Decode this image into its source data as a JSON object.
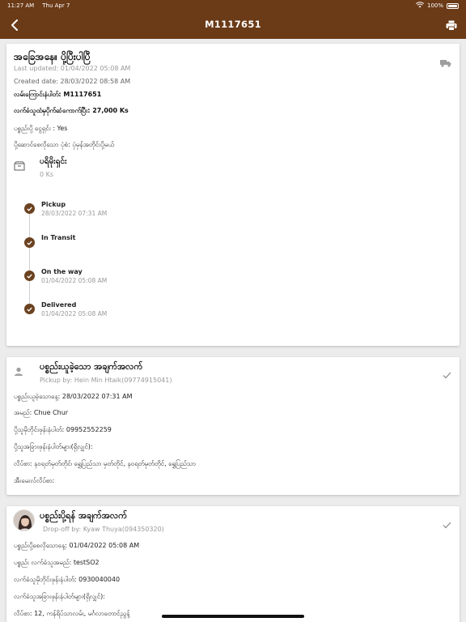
{
  "status_bar": {
    "time": "11:27 AM",
    "date": "Thu Apr 7",
    "battery": "100%"
  },
  "header": {
    "title": "M1117651"
  },
  "order": {
    "status_title": "အခြေအနေ။ ပို့ပြီးပါပြီ",
    "last_updated": "Last updated: 01/04/2022 05:08 AM",
    "created_date": "Created date: 28/03/2022 08:58 AM",
    "tracking_number": "လမ်းကြောင်းနံပါတ်: M1117651",
    "amount_to_collect": "လက်ခံသူထံမှပိုက်ဆံကောက်ပြီး: 27,000 Ks",
    "parcel_cash": "ပစ္စည်းပို့ ငွေရှင်း : Yes",
    "delivery_type": "ပို့ဆောင်စေလိုသော ပုံစံ: ပုံမှန်အတိုင်းပို့မယ်",
    "balance_label": "ပရိမိုးရှင်း",
    "balance_value": "0 Ks"
  },
  "timeline": [
    {
      "label": "Pickup",
      "date": "28/03/2022 07:31 AM"
    },
    {
      "label": "In Transit",
      "date": ""
    },
    {
      "label": "On the way",
      "date": "01/04/2022 05:08 AM"
    },
    {
      "label": "Delivered",
      "date": "01/04/2022 05:08 AM"
    }
  ],
  "pickup": {
    "title": "ပစ္စည်းယူခဲ့သော အချက်အလက်",
    "by": "Pickup by: Hein Min Htaik(09774915041)",
    "date": "ပစ္စည်းယူခဲ့သောနေ့: 28/03/2022 07:31 AM",
    "name": "အမည်: Chue Chur",
    "phone": "ပို့သူမိုဘိုင်းဖုန်းနံပါတ်: 09952552259",
    "other_phones": "ပို့သူအခြားဖုန်းနံပါတ်များ(ရှိလျှင်):",
    "address": "လိပ်စာ: နဝရတ်မှတ်တိုင်၊ ရွှေပြည်သာ မှတ်တိုင်, နဝရတ်မှတ်တိုင်, ရွှေပြည်သာ",
    "email": "အီးမေးလ်လိပ်စာ:"
  },
  "dropoff": {
    "title": "ပစ္စည်းပို့ရန် အချက်အလက်",
    "by": "Drop-off by: Kyaw Thuya(094350320)",
    "date": "ပစ္စည်းပို့စေလိုသောနေ့: 01/04/2022 05:08 AM",
    "receiver": "ပစ္စည်း လက်ခံသူအမည်: testSO2",
    "phone": "လက်ခံသူမိုဘိုင်းဖုန်းနံပါတ်: 0930040040",
    "other_phones": "လက်ခံသူအခြားဖုန်းနံပါတ်များ(ရှိလျှင်):",
    "address": "လိပ်စာ: 12, ကန်ရိပ်သာလမ်း, မင်္ဂလာတောင်ညွန့်"
  },
  "colors": {
    "brand": "#6b3a17",
    "timeline_dot": "#6b4220"
  }
}
